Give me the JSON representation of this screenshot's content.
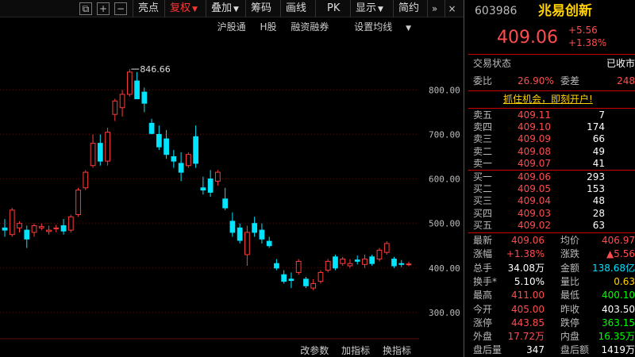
{
  "toolbar": {
    "icons": [
      {
        "name": "window-restore-icon",
        "glyph": "⧉"
      },
      {
        "name": "plus-icon",
        "glyph": "+"
      },
      {
        "name": "minus-icon",
        "glyph": "−"
      }
    ],
    "buttons": [
      {
        "label": "亮点",
        "caret": false,
        "active": false
      },
      {
        "label": "复权",
        "caret": true,
        "active": true
      },
      {
        "label": "叠加",
        "caret": true,
        "active": false
      },
      {
        "label": "筹码",
        "caret": false,
        "active": false
      },
      {
        "label": "画线",
        "caret": false,
        "active": false
      },
      {
        "label": "PK",
        "caret": false,
        "active": false
      },
      {
        "label": "显示",
        "caret": true,
        "active": false
      },
      {
        "label": "简约",
        "caret": false,
        "active": false
      }
    ],
    "nav_forward": "»",
    "nav_close": "×"
  },
  "chart_subbar": [
    "沪股通",
    "H股",
    "融资融券",
    "设置均线"
  ],
  "chart_bottom": [
    "改参数",
    "加指标",
    "换指标"
  ],
  "chart_data": {
    "type": "candlestick",
    "price_axis": [
      800.0,
      700.0,
      600.0,
      500.0,
      400.0,
      300.0
    ],
    "ylim": [
      250,
      870
    ],
    "max_label": "846.66",
    "candles": [
      {
        "o": 490,
        "h": 510,
        "l": 470,
        "c": 485
      },
      {
        "o": 475,
        "h": 535,
        "l": 470,
        "c": 530
      },
      {
        "o": 490,
        "h": 505,
        "l": 480,
        "c": 500
      },
      {
        "o": 485,
        "h": 495,
        "l": 445,
        "c": 465
      },
      {
        "o": 480,
        "h": 500,
        "l": 470,
        "c": 495
      },
      {
        "o": 490,
        "h": 500,
        "l": 485,
        "c": 493
      },
      {
        "o": 482,
        "h": 495,
        "l": 475,
        "c": 485
      },
      {
        "o": 488,
        "h": 497,
        "l": 480,
        "c": 490
      },
      {
        "o": 495,
        "h": 510,
        "l": 475,
        "c": 483
      },
      {
        "o": 485,
        "h": 520,
        "l": 480,
        "c": 515
      },
      {
        "o": 520,
        "h": 580,
        "l": 515,
        "c": 575
      },
      {
        "o": 580,
        "h": 620,
        "l": 575,
        "c": 615
      },
      {
        "o": 630,
        "h": 700,
        "l": 625,
        "c": 680
      },
      {
        "o": 680,
        "h": 700,
        "l": 630,
        "c": 640
      },
      {
        "o": 640,
        "h": 715,
        "l": 630,
        "c": 705
      },
      {
        "o": 745,
        "h": 780,
        "l": 730,
        "c": 775
      },
      {
        "o": 760,
        "h": 800,
        "l": 740,
        "c": 790
      },
      {
        "o": 790,
        "h": 846.66,
        "l": 785,
        "c": 840
      },
      {
        "o": 820,
        "h": 840,
        "l": 780,
        "c": 780
      },
      {
        "o": 795,
        "h": 805,
        "l": 750,
        "c": 770
      },
      {
        "o": 725,
        "h": 735,
        "l": 700,
        "c": 702
      },
      {
        "o": 700,
        "h": 720,
        "l": 665,
        "c": 672
      },
      {
        "o": 690,
        "h": 710,
        "l": 645,
        "c": 655
      },
      {
        "o": 650,
        "h": 665,
        "l": 625,
        "c": 640
      },
      {
        "o": 635,
        "h": 660,
        "l": 595,
        "c": 615
      },
      {
        "o": 630,
        "h": 660,
        "l": 625,
        "c": 655
      },
      {
        "o": 695,
        "h": 720,
        "l": 625,
        "c": 635
      },
      {
        "o": 580,
        "h": 605,
        "l": 565,
        "c": 575
      },
      {
        "o": 600,
        "h": 620,
        "l": 560,
        "c": 570
      },
      {
        "o": 595,
        "h": 620,
        "l": 585,
        "c": 615
      },
      {
        "o": 555,
        "h": 580,
        "l": 530,
        "c": 535
      },
      {
        "o": 505,
        "h": 525,
        "l": 470,
        "c": 480
      },
      {
        "o": 490,
        "h": 500,
        "l": 455,
        "c": 462
      },
      {
        "o": 430,
        "h": 495,
        "l": 405,
        "c": 480
      },
      {
        "o": 500,
        "h": 515,
        "l": 470,
        "c": 480
      },
      {
        "o": 485,
        "h": 500,
        "l": 455,
        "c": 465
      },
      {
        "o": 460,
        "h": 470,
        "l": 445,
        "c": 450
      },
      {
        "o": 410,
        "h": 420,
        "l": 395,
        "c": 400
      },
      {
        "o": 385,
        "h": 395,
        "l": 365,
        "c": 370
      },
      {
        "o": 375,
        "h": 390,
        "l": 355,
        "c": 372
      },
      {
        "o": 390,
        "h": 420,
        "l": 385,
        "c": 415
      },
      {
        "o": 375,
        "h": 380,
        "l": 355,
        "c": 360
      },
      {
        "o": 355,
        "h": 375,
        "l": 350,
        "c": 365
      },
      {
        "o": 370,
        "h": 395,
        "l": 365,
        "c": 390
      },
      {
        "o": 395,
        "h": 420,
        "l": 390,
        "c": 415
      },
      {
        "o": 425,
        "h": 430,
        "l": 395,
        "c": 400
      },
      {
        "o": 410,
        "h": 425,
        "l": 405,
        "c": 420
      },
      {
        "o": 405,
        "h": 420,
        "l": 400,
        "c": 410
      },
      {
        "o": 418,
        "h": 428,
        "l": 408,
        "c": 415
      },
      {
        "o": 408,
        "h": 430,
        "l": 400,
        "c": 420
      },
      {
        "o": 425,
        "h": 430,
        "l": 405,
        "c": 410
      },
      {
        "o": 420,
        "h": 445,
        "l": 415,
        "c": 440
      },
      {
        "o": 435,
        "h": 460,
        "l": 430,
        "c": 455
      },
      {
        "o": 420,
        "h": 425,
        "l": 400,
        "c": 405
      },
      {
        "o": 410,
        "h": 418,
        "l": 402,
        "c": 408
      },
      {
        "o": 408,
        "h": 414,
        "l": 404,
        "c": 409
      }
    ]
  },
  "quote": {
    "code": "603986",
    "name": "兆易创新",
    "price": "409.06",
    "change": "+5.56",
    "change_pct": "+1.38%",
    "trade_status_label": "交易状态",
    "trade_status": "已收市",
    "weibi_label": "委比",
    "weibi": "26.90%",
    "weicha_label": "委差",
    "weicha": "248",
    "promo": "抓住机会，即刻开户!",
    "asks": [
      {
        "label": "卖五",
        "price": "409.11",
        "vol": "7"
      },
      {
        "label": "卖四",
        "price": "409.10",
        "vol": "174"
      },
      {
        "label": "卖三",
        "price": "409.09",
        "vol": "66"
      },
      {
        "label": "卖二",
        "price": "409.08",
        "vol": "49"
      },
      {
        "label": "卖一",
        "price": "409.07",
        "vol": "41"
      }
    ],
    "bids": [
      {
        "label": "买一",
        "price": "409.06",
        "vol": "293"
      },
      {
        "label": "买二",
        "price": "409.05",
        "vol": "153"
      },
      {
        "label": "买三",
        "price": "409.04",
        "vol": "48"
      },
      {
        "label": "买四",
        "price": "409.03",
        "vol": "28"
      },
      {
        "label": "买五",
        "price": "409.02",
        "vol": "63"
      }
    ],
    "stats": [
      {
        "l1": "最新",
        "v1": "409.06",
        "c1": "red",
        "l2": "均价",
        "v2": "406.97",
        "c2": "red"
      },
      {
        "l1": "涨幅",
        "v1": "+1.38%",
        "c1": "red",
        "l2": "涨跌",
        "v2": "▲5.56",
        "c2": "red"
      },
      {
        "l1": "总手",
        "v1": "34.08万",
        "c1": "white",
        "l2": "金额",
        "v2": "138.68亿",
        "c2": "cyan"
      },
      {
        "l1": "换手*",
        "v1": "5.10%",
        "c1": "white",
        "l2": "量比",
        "v2": "0.63",
        "c2": "yellow"
      },
      {
        "l1": "最高",
        "v1": "411.00",
        "c1": "red",
        "l2": "最低",
        "v2": "400.10",
        "c2": "green"
      },
      {
        "l1": "今开",
        "v1": "405.00",
        "c1": "red",
        "l2": "昨收",
        "v2": "403.50",
        "c2": "white"
      },
      {
        "l1": "涨停",
        "v1": "443.85",
        "c1": "red",
        "l2": "跌停",
        "v2": "363.15",
        "c2": "green"
      },
      {
        "l1": "外盘",
        "v1": "17.72万",
        "c1": "red",
        "l2": "内盘",
        "v2": "16.35万",
        "c2": "green"
      },
      {
        "l1": "盘后量",
        "v1": "347",
        "c1": "white",
        "l2": "盘后额",
        "v2": "1419万",
        "c2": "white"
      }
    ]
  }
}
